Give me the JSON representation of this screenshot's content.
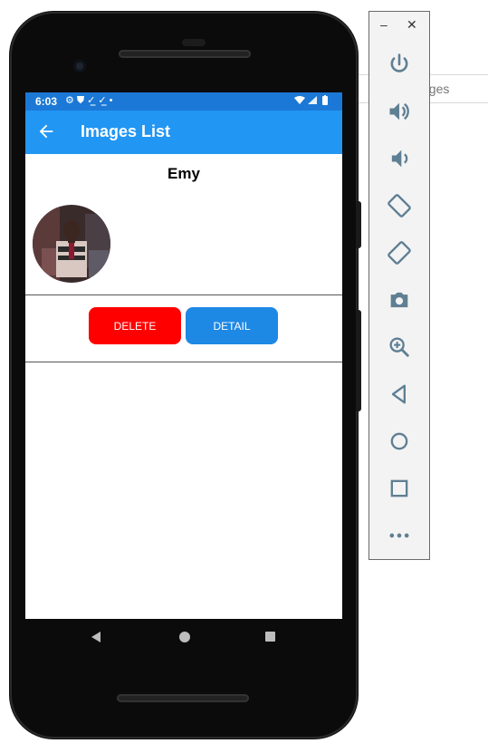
{
  "background_window": {
    "search_text_fragment": "ages"
  },
  "status_bar": {
    "time": "6:03",
    "icons": [
      "settings-icon",
      "shield-icon",
      "checklist-icon",
      "checklist-icon",
      "dot-icon"
    ],
    "right_icons": [
      "wifi-icon",
      "signal-icon",
      "battery-icon"
    ]
  },
  "app_bar": {
    "title": "Images List",
    "back_icon": "arrow-back-icon",
    "color": "#2196f3",
    "status_color": "#1c78d6"
  },
  "content": {
    "name": "Emy",
    "avatar_icon": "profile-photo",
    "buttons": {
      "delete_label": "DELETE",
      "detail_label": "DETAIL"
    },
    "colors": {
      "delete": "#ff0000",
      "detail": "#1e88e5"
    }
  },
  "nav_bar": {
    "icons": [
      "back-triangle-icon",
      "home-circle-icon",
      "recents-square-icon"
    ]
  },
  "toolbar": {
    "window_controls": {
      "minimize": "–",
      "close": "✕"
    },
    "buttons": [
      "power-icon",
      "volume-up-icon",
      "volume-down-icon",
      "rotate-left-icon",
      "rotate-right-icon",
      "camera-icon",
      "zoom-icon",
      "back-icon",
      "home-icon",
      "overview-icon",
      "more-icon"
    ],
    "icon_color": "#5f7f93"
  }
}
